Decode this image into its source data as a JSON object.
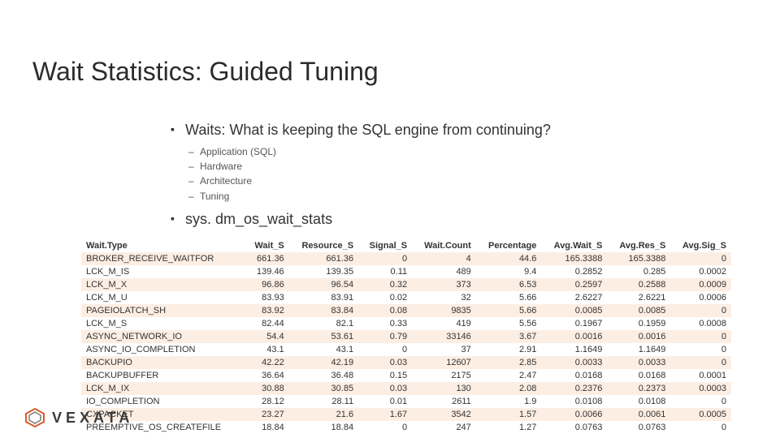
{
  "title": "Wait Statistics:  Guided Tuning",
  "bullets": {
    "b1": "Waits:  What is keeping the SQL engine from continuing?",
    "sub": {
      "s1": "Application (SQL)",
      "s2": "Hardware",
      "s3": "Architecture",
      "s4": "Tuning"
    },
    "b2": "sys. dm_os_wait_stats"
  },
  "table": {
    "headers": {
      "c0": "Wait.Type",
      "c1": "Wait_S",
      "c2": "Resource_S",
      "c3": "Signal_S",
      "c4": "Wait.Count",
      "c5": "Percentage",
      "c6": "Avg.Wait_S",
      "c7": "Avg.Res_S",
      "c8": "Avg.Sig_S"
    },
    "rows": [
      {
        "c0": "BROKER_RECEIVE_WAITFOR",
        "c1": "661.36",
        "c2": "661.36",
        "c3": "0",
        "c4": "4",
        "c5": "44.6",
        "c6": "165.3388",
        "c7": "165.3388",
        "c8": "0"
      },
      {
        "c0": "LCK_M_IS",
        "c1": "139.46",
        "c2": "139.35",
        "c3": "0.11",
        "c4": "489",
        "c5": "9.4",
        "c6": "0.2852",
        "c7": "0.285",
        "c8": "0.0002"
      },
      {
        "c0": "LCK_M_X",
        "c1": "96.86",
        "c2": "96.54",
        "c3": "0.32",
        "c4": "373",
        "c5": "6.53",
        "c6": "0.2597",
        "c7": "0.2588",
        "c8": "0.0009"
      },
      {
        "c0": "LCK_M_U",
        "c1": "83.93",
        "c2": "83.91",
        "c3": "0.02",
        "c4": "32",
        "c5": "5.66",
        "c6": "2.6227",
        "c7": "2.6221",
        "c8": "0.0006"
      },
      {
        "c0": "PAGEIOLATCH_SH",
        "c1": "83.92",
        "c2": "83.84",
        "c3": "0.08",
        "c4": "9835",
        "c5": "5.66",
        "c6": "0.0085",
        "c7": "0.0085",
        "c8": "0"
      },
      {
        "c0": "LCK_M_S",
        "c1": "82.44",
        "c2": "82.1",
        "c3": "0.33",
        "c4": "419",
        "c5": "5.56",
        "c6": "0.1967",
        "c7": "0.1959",
        "c8": "0.0008"
      },
      {
        "c0": "ASYNC_NETWORK_IO",
        "c1": "54.4",
        "c2": "53.61",
        "c3": "0.79",
        "c4": "33146",
        "c5": "3.67",
        "c6": "0.0016",
        "c7": "0.0016",
        "c8": "0"
      },
      {
        "c0": "ASYNC_IO_COMPLETION",
        "c1": "43.1",
        "c2": "43.1",
        "c3": "0",
        "c4": "37",
        "c5": "2.91",
        "c6": "1.1649",
        "c7": "1.1649",
        "c8": "0"
      },
      {
        "c0": "BACKUPIO",
        "c1": "42.22",
        "c2": "42.19",
        "c3": "0.03",
        "c4": "12607",
        "c5": "2.85",
        "c6": "0.0033",
        "c7": "0.0033",
        "c8": "0"
      },
      {
        "c0": "BACKUPBUFFER",
        "c1": "36.64",
        "c2": "36.48",
        "c3": "0.15",
        "c4": "2175",
        "c5": "2.47",
        "c6": "0.0168",
        "c7": "0.0168",
        "c8": "0.0001"
      },
      {
        "c0": "LCK_M_IX",
        "c1": "30.88",
        "c2": "30.85",
        "c3": "0.03",
        "c4": "130",
        "c5": "2.08",
        "c6": "0.2376",
        "c7": "0.2373",
        "c8": "0.0003"
      },
      {
        "c0": "IO_COMPLETION",
        "c1": "28.12",
        "c2": "28.11",
        "c3": "0.01",
        "c4": "2611",
        "c5": "1.9",
        "c6": "0.0108",
        "c7": "0.0108",
        "c8": "0"
      },
      {
        "c0": "CXPACKET",
        "c1": "23.27",
        "c2": "21.6",
        "c3": "1.67",
        "c4": "3542",
        "c5": "1.57",
        "c6": "0.0066",
        "c7": "0.0061",
        "c8": "0.0005"
      },
      {
        "c0": "PREEMPTIVE_OS_CREATEFILE",
        "c1": "18.84",
        "c2": "18.84",
        "c3": "0",
        "c4": "247",
        "c5": "1.27",
        "c6": "0.0763",
        "c7": "0.0763",
        "c8": "0"
      }
    ]
  },
  "brand": {
    "name": "VEXATA"
  }
}
